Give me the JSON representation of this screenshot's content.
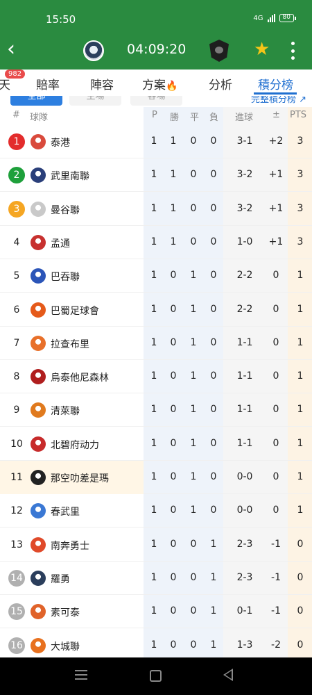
{
  "status": {
    "time": "15:50",
    "network": "4G",
    "battery": "80"
  },
  "header": {
    "clock": "04:09:20",
    "home_logo": "home-team-crest",
    "away_logo": "away-team-crest"
  },
  "tabs": [
    {
      "label": "天"
    },
    {
      "label": "賠率"
    },
    {
      "label": "陣容"
    },
    {
      "label": "方案"
    },
    {
      "label": "分析"
    },
    {
      "label": "積分榜",
      "active": true
    }
  ],
  "tab_badge": "982",
  "filters": {
    "all": "全部",
    "home": "主場",
    "away": "客場",
    "full_table": "完整積分榜 ↗"
  },
  "columns": {
    "rank": "#",
    "team": "球隊",
    "p": "P",
    "w": "勝",
    "d": "平",
    "l": "負",
    "goals": "進球",
    "diff": "±",
    "pts": "PTS"
  },
  "rows": [
    {
      "rank": "1",
      "team": "泰港",
      "p": "1",
      "w": "1",
      "d": "0",
      "l": "0",
      "goals": "3-1",
      "diff": "+2",
      "pts": "3",
      "logo_color": "#d94a3c"
    },
    {
      "rank": "2",
      "team": "武里南聯",
      "p": "1",
      "w": "1",
      "d": "0",
      "l": "0",
      "goals": "3-2",
      "diff": "+1",
      "pts": "3",
      "logo_color": "#2a3f7a"
    },
    {
      "rank": "3",
      "team": "曼谷聯",
      "p": "1",
      "w": "1",
      "d": "0",
      "l": "0",
      "goals": "3-2",
      "diff": "+1",
      "pts": "3",
      "logo_color": "#c9c9c9"
    },
    {
      "rank": "4",
      "team": "孟通",
      "p": "1",
      "w": "1",
      "d": "0",
      "l": "0",
      "goals": "1-0",
      "diff": "+1",
      "pts": "3",
      "logo_color": "#c7312f"
    },
    {
      "rank": "5",
      "team": "巴吞聯",
      "p": "1",
      "w": "0",
      "d": "1",
      "l": "0",
      "goals": "2-2",
      "diff": "0",
      "pts": "1",
      "logo_color": "#2b55b8"
    },
    {
      "rank": "6",
      "team": "巴蜀足球會",
      "p": "1",
      "w": "0",
      "d": "1",
      "l": "0",
      "goals": "2-2",
      "diff": "0",
      "pts": "1",
      "logo_color": "#e55a1a"
    },
    {
      "rank": "7",
      "team": "拉查布里",
      "p": "1",
      "w": "0",
      "d": "1",
      "l": "0",
      "goals": "1-1",
      "diff": "0",
      "pts": "1",
      "logo_color": "#e8702a"
    },
    {
      "rank": "8",
      "team": "烏泰他尼森林",
      "p": "1",
      "w": "0",
      "d": "1",
      "l": "0",
      "goals": "1-1",
      "diff": "0",
      "pts": "1",
      "logo_color": "#b01e1e"
    },
    {
      "rank": "9",
      "team": "清萊聯",
      "p": "1",
      "w": "0",
      "d": "1",
      "l": "0",
      "goals": "1-1",
      "diff": "0",
      "pts": "1",
      "logo_color": "#e07a1e"
    },
    {
      "rank": "10",
      "team": "北碧府动力",
      "p": "1",
      "w": "0",
      "d": "1",
      "l": "0",
      "goals": "1-1",
      "diff": "0",
      "pts": "1",
      "logo_color": "#c72b2b"
    },
    {
      "rank": "11",
      "team": "那空叻差是瑪",
      "p": "1",
      "w": "0",
      "d": "1",
      "l": "0",
      "goals": "0-0",
      "diff": "0",
      "pts": "1",
      "logo_color": "#222222",
      "highlight": true
    },
    {
      "rank": "12",
      "team": "春武里",
      "p": "1",
      "w": "0",
      "d": "1",
      "l": "0",
      "goals": "0-0",
      "diff": "0",
      "pts": "1",
      "logo_color": "#3a78d4"
    },
    {
      "rank": "13",
      "team": "南奔勇士",
      "p": "1",
      "w": "0",
      "d": "0",
      "l": "1",
      "goals": "2-3",
      "diff": "-1",
      "pts": "0",
      "logo_color": "#e04a2a"
    },
    {
      "rank": "14",
      "team": "羅勇",
      "p": "1",
      "w": "0",
      "d": "0",
      "l": "1",
      "goals": "2-3",
      "diff": "-1",
      "pts": "0",
      "logo_color": "#2b3e5c"
    },
    {
      "rank": "15",
      "team": "素可泰",
      "p": "1",
      "w": "0",
      "d": "0",
      "l": "1",
      "goals": "0-1",
      "diff": "-1",
      "pts": "0",
      "logo_color": "#e0632a"
    },
    {
      "rank": "16",
      "team": "大城聯",
      "p": "1",
      "w": "0",
      "d": "0",
      "l": "1",
      "goals": "1-3",
      "diff": "-2",
      "pts": "0",
      "logo_color": "#e8711f"
    }
  ]
}
